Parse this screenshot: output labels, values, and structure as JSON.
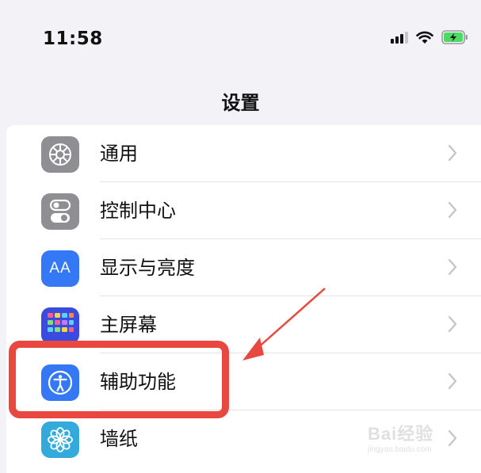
{
  "status_bar": {
    "time": "11:58",
    "icons": [
      "signal-icon",
      "wifi-icon",
      "battery-charging-icon"
    ]
  },
  "nav": {
    "title": "设置"
  },
  "settings": [
    {
      "label": "通用",
      "icon": "gear-icon",
      "icon_color": "#8e8e93"
    },
    {
      "label": "控制中心",
      "icon": "toggle-switches-icon",
      "icon_color": "#8e8e93"
    },
    {
      "label": "显示与亮度",
      "icon": "text-size-icon",
      "icon_text": "AA",
      "icon_color": "#3478f6"
    },
    {
      "label": "主屏幕",
      "icon": "home-screen-grid-icon",
      "icon_color": "#3b4be0"
    },
    {
      "label": "辅助功能",
      "icon": "accessibility-icon",
      "icon_color": "#3478f6"
    },
    {
      "label": "墙纸",
      "icon": "flower-icon",
      "icon_color": "#34aadc"
    }
  ],
  "annotation": {
    "highlight_color": "#e8483f"
  },
  "watermark": {
    "brand": "Bai经验",
    "url": "jingyan.baidu.com"
  }
}
